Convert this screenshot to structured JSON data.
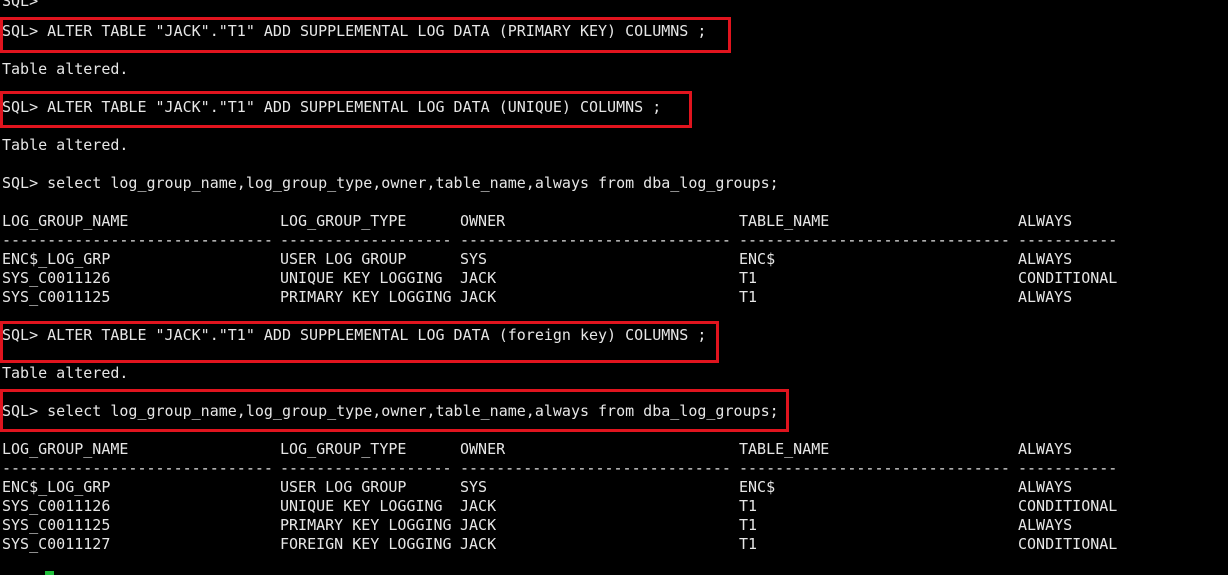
{
  "terminal": {
    "prompt_top": "SQL>",
    "cmd1": "SQL> ALTER TABLE \"JACK\".\"T1\" ADD SUPPLEMENTAL LOG DATA (PRIMARY KEY) COLUMNS ;",
    "msg1": "Table altered.",
    "cmd2": "SQL> ALTER TABLE \"JACK\".\"T1\" ADD SUPPLEMENTAL LOG DATA (UNIQUE) COLUMNS ;",
    "msg2": "Table altered.",
    "query1": "SQL> select log_group_name,log_group_type,owner,table_name,always from dba_log_groups;",
    "cmd3": "SQL> ALTER TABLE \"JACK\".\"T1\" ADD SUPPLEMENTAL LOG DATA (foreign key) COLUMNS ;",
    "msg3": "Table altered.",
    "query2": "SQL> select log_group_name,log_group_type,owner,table_name,always from dba_log_groups;"
  },
  "result_headers": [
    "LOG_GROUP_NAME",
    "LOG_GROUP_TYPE",
    "OWNER",
    "TABLE_NAME",
    "ALWAYS"
  ],
  "result_separators": [
    "------------------------------",
    "-------------------",
    "------------------------------",
    "------------------------------",
    "-----------"
  ],
  "result1_rows": [
    [
      "ENC$_LOG_GRP",
      "USER LOG GROUP",
      "SYS",
      "ENC$",
      "ALWAYS"
    ],
    [
      "SYS_C0011126",
      "UNIQUE KEY LOGGING",
      "JACK",
      "T1",
      "CONDITIONAL"
    ],
    [
      "SYS_C0011125",
      "PRIMARY KEY LOGGING",
      "JACK",
      "T1",
      "ALWAYS"
    ]
  ],
  "result2_rows": [
    [
      "ENC$_LOG_GRP",
      "USER LOG GROUP",
      "SYS",
      "ENC$",
      "ALWAYS"
    ],
    [
      "SYS_C0011126",
      "UNIQUE KEY LOGGING",
      "JACK",
      "T1",
      "CONDITIONAL"
    ],
    [
      "SYS_C0011125",
      "PRIMARY KEY LOGGING",
      "JACK",
      "T1",
      "ALWAYS"
    ],
    [
      "SYS_C0011127",
      "FOREIGN KEY LOGGING",
      "JACK",
      "T1",
      "CONDITIONAL"
    ]
  ],
  "colors": {
    "background": "#000000",
    "text": "#e6e6e6",
    "highlight_box": "#e0141e",
    "cursor": "#1fbf3a"
  }
}
